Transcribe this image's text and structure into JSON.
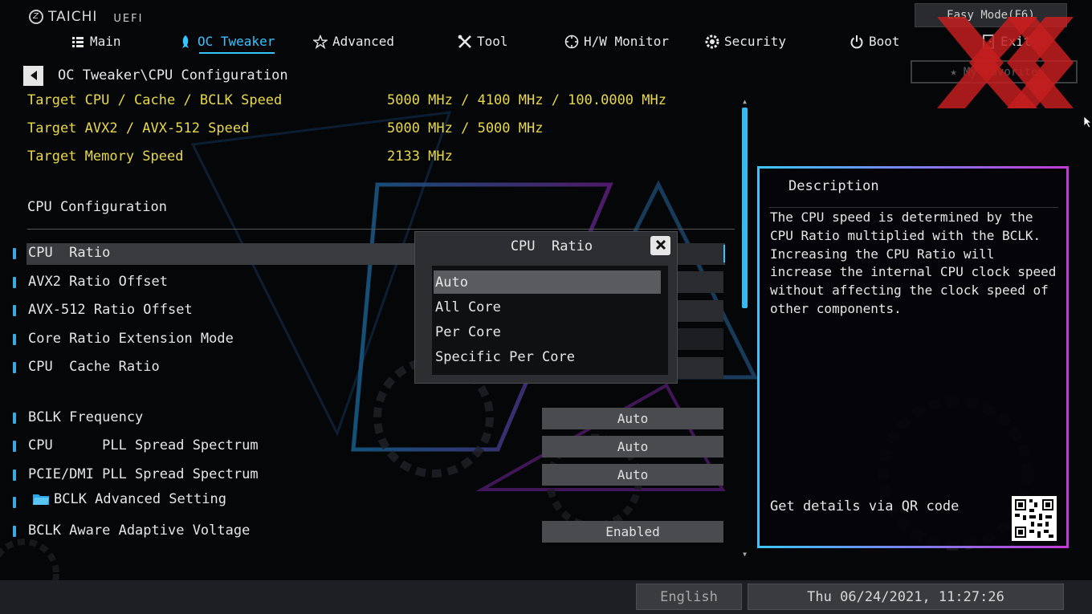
{
  "brand": {
    "name": "TAICHI",
    "suffix": "UEFI"
  },
  "nav": {
    "items": [
      {
        "label": "Main",
        "icon": "list-icon"
      },
      {
        "label": "OC Tweaker",
        "icon": "rocket-icon",
        "active": true
      },
      {
        "label": "Advanced",
        "icon": "star-icon"
      },
      {
        "label": "Tool",
        "icon": "tools-icon"
      },
      {
        "label": "H/W Monitor",
        "icon": "crosshair-icon"
      },
      {
        "label": "Security",
        "icon": "shield-icon"
      },
      {
        "label": "Boot",
        "icon": "power-icon"
      }
    ],
    "exit_label": "Exit"
  },
  "header": {
    "easy_mode": "Easy Mode(F6)",
    "favorite": "My Favorite"
  },
  "breadcrumb": "OC Tweaker\\CPU Configuration",
  "targets": [
    {
      "label": "Target CPU / Cache / BCLK Speed",
      "value": "5000 MHz / 4100 MHz / 100.0000 MHz"
    },
    {
      "label": "Target AVX2 / AVX-512 Speed",
      "value": "5000 MHz / 5000 MHz"
    },
    {
      "label": "Target Memory Speed",
      "value": "2133 MHz"
    }
  ],
  "section_title": "CPU Configuration",
  "settings": [
    {
      "label": "CPU  Ratio",
      "value": "Auto"
    },
    {
      "label": "AVX2 Ratio Offset",
      "value": ""
    },
    {
      "label": "AVX-512 Ratio Offset",
      "value": ""
    },
    {
      "label": "Core Ratio Extension Mode",
      "value": ""
    },
    {
      "label": "CPU  Cache Ratio",
      "value": ""
    },
    {
      "label": "BCLK Frequency",
      "value": "Auto"
    },
    {
      "label": "CPU      PLL Spread Spectrum",
      "value": "Auto"
    },
    {
      "label": "PCIE/DMI PLL Spread Spectrum",
      "value": "Auto"
    },
    {
      "label": "BCLK Advanced Setting",
      "value": ""
    },
    {
      "label": "BCLK Aware Adaptive Voltage",
      "value": "Enabled"
    }
  ],
  "popup": {
    "title": "CPU  Ratio",
    "options": [
      "Auto",
      "All Core",
      "Per Core",
      "Specific Per Core"
    ],
    "selected": "Auto"
  },
  "description": {
    "title": "Description",
    "lines": [
      "The CPU speed is determined by the",
      "CPU Ratio multiplied with the BCLK.",
      "Increasing the CPU Ratio will",
      "increase the internal CPU clock speed",
      "without affecting the clock speed of",
      "other components."
    ],
    "qr_label": "Get details via QR code"
  },
  "footer": {
    "language": "English",
    "datetime": "Thu 06/24/2021, 11:27:26"
  },
  "colors": {
    "accent": "#39c3ff",
    "target_text": "#e8d84a",
    "watermark": "#c41e1e"
  }
}
